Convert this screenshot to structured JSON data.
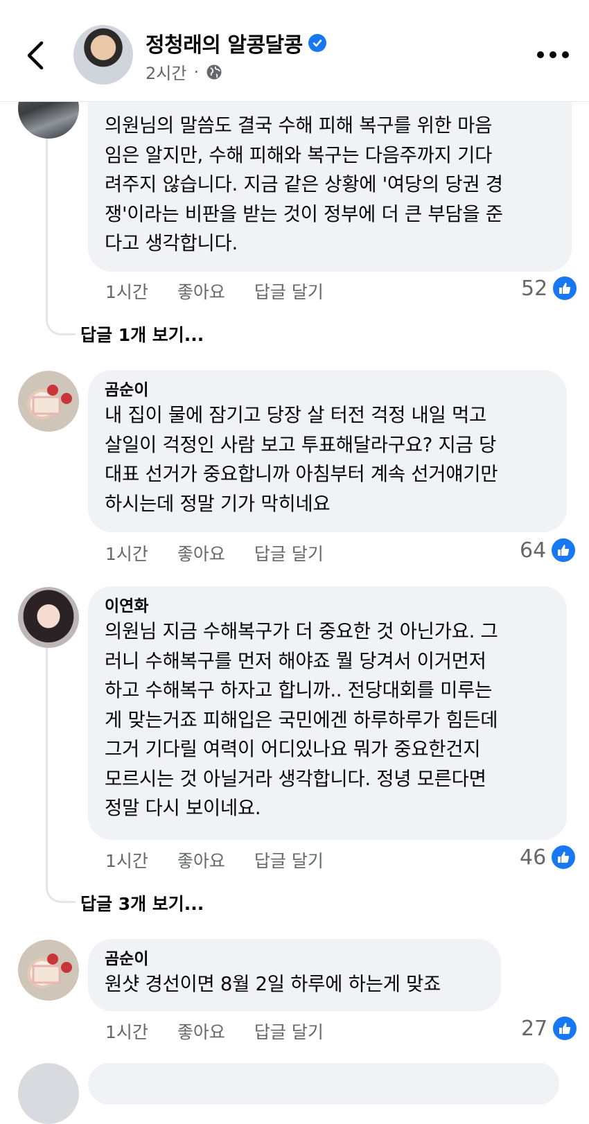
{
  "header": {
    "page_name": "정청래의 알콩달콩",
    "time": "2시간",
    "separator": "·"
  },
  "comments": [
    {
      "name": "",
      "text": "의원님의 말씀도 결국 수해 피해 복구를 위한 마음\n임은 알지만, 수해 피해와 복구는 다음주까지 기다\n려주지 않습니다. 지금 같은 상황에 '여당의 당권 경\n쟁'이라는 비판을 받는 것이 정부에 더 큰 부담을 준\n다고 생각합니다.",
      "time": "1시간",
      "like_label": "좋아요",
      "reply_label": "답글 달기",
      "likes": "52"
    },
    {
      "name": "곰순이",
      "text": "내 집이 물에 잠기고 당장 살 터전 걱정 내일 먹고\n살일이 걱정인 사람 보고 투표해달라구요? 지금 당\n대표 선거가 중요합니까 아침부터 계속 선거얘기만\n하시는데 정말 기가 막히네요",
      "time": "1시간",
      "like_label": "좋아요",
      "reply_label": "답글 달기",
      "likes": "64"
    },
    {
      "name": "이연화",
      "text": "의원님 지금 수해복구가 더 중요한 것 아닌가요. 그\n러니 수해복구를 먼저 해야죠 뭘 당겨서 이거먼저\n하고 수해복구 하자고 합니까.. 전당대회를 미루는\n게 맞는거죠 피해입은 국민에겐 하루하루가 힘든데\n그거 기다릴 여력이 어디있나요 뭐가 중요한건지\n모르시는 것 아닐거라 생각합니다. 정녕 모른다면\n정말 다시 보이네요.",
      "time": "1시간",
      "like_label": "좋아요",
      "reply_label": "답글 달기",
      "likes": "46"
    },
    {
      "name": "곰순이",
      "text": "원샷 경선이면 8월 2일 하루에 하는게 맞죠",
      "time": "1시간",
      "like_label": "좋아요",
      "reply_label": "답글 달기",
      "likes": "27"
    }
  ],
  "view_replies": [
    "답글 1개 보기...",
    "답글 3개 보기..."
  ],
  "colors": {
    "accent": "#1877f2",
    "bubble": "#f0f2f5",
    "muted": "#65676b"
  }
}
